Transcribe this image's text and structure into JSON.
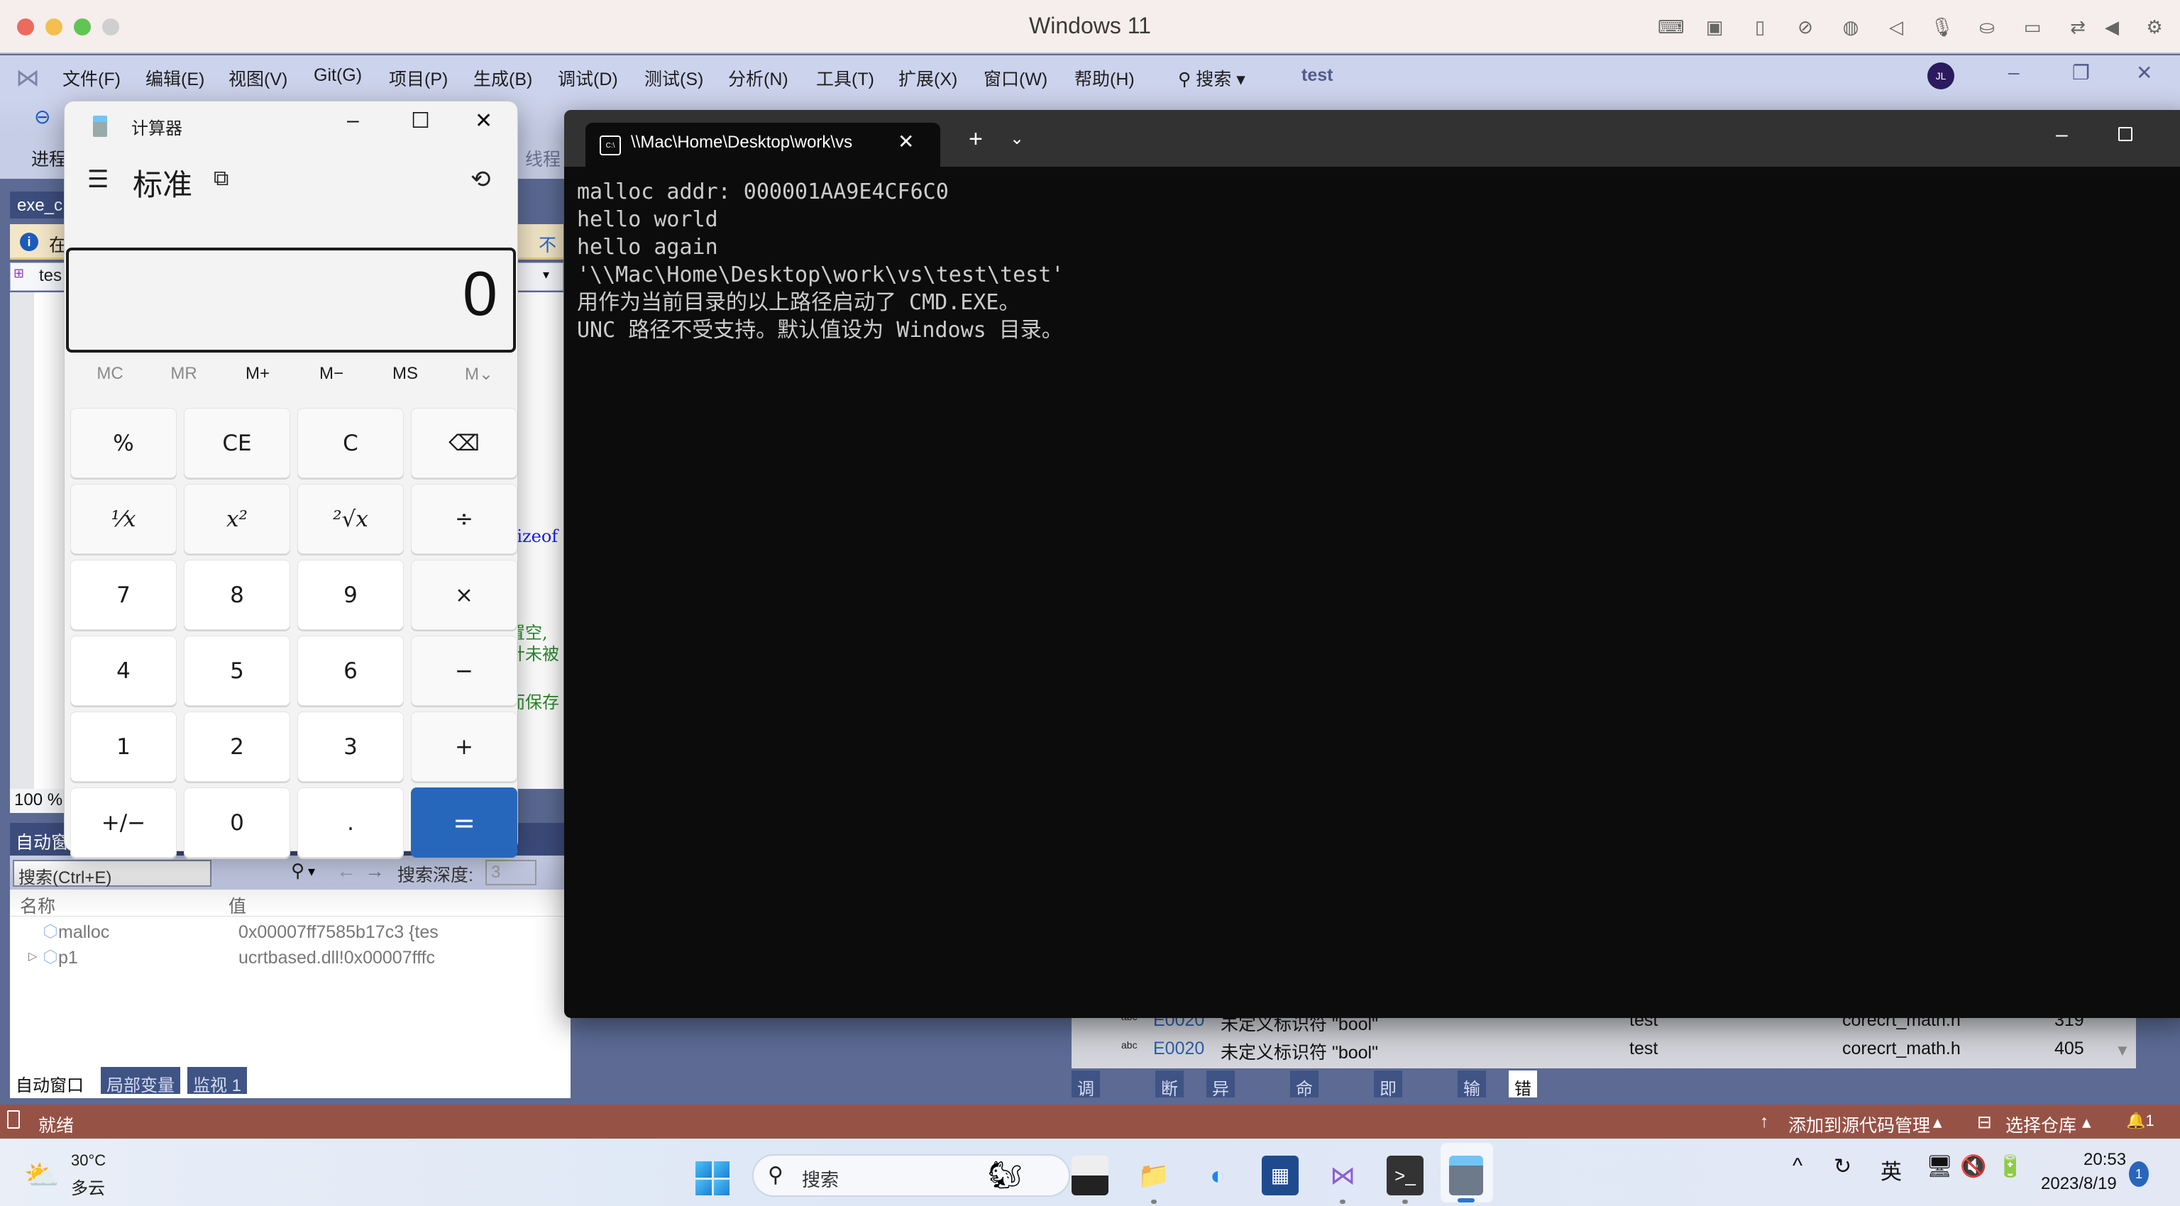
{
  "mac": {
    "title": "Windows 11",
    "traffic_lights": [
      "close",
      "minimize",
      "zoom",
      "fullscreen-disabled"
    ],
    "toolbar_icons": [
      "keyboard-icon",
      "cpu-icon",
      "usb-icon",
      "network-off-icon",
      "globe-icon",
      "speaker-icon",
      "microphone-icon",
      "disk-icon",
      "camera-icon",
      "share-icon",
      "arrow-left-icon",
      "gear-icon"
    ]
  },
  "vs": {
    "menu": [
      "文件(F)",
      "编辑(E)",
      "视图(V)",
      "Git(G)",
      "项目(P)",
      "生成(B)",
      "调试(D)",
      "测试(S)",
      "分析(N)",
      "工具(T)",
      "扩展(X)",
      "窗口(W)",
      "帮助(H)"
    ],
    "search_label": "搜索",
    "solution_name": "test",
    "avatar": "JL",
    "toolbar_process_label": "进程",
    "toolbar_thread_label": "线程",
    "doc_tab": "exe_c",
    "infobar_text": "在",
    "infobar_link": "不再",
    "nav_text": "tes",
    "code_fragments": [
      "sizeof",
      "置空,",
      "针未被",
      "而保存"
    ],
    "zoom_level": "100 %",
    "status_text": "就绪",
    "status_add_source": "添加到源代码管理",
    "status_select_repo": "选择仓库",
    "notifications": "1"
  },
  "auto_window": {
    "title": "自动窗口",
    "search_placeholder": "搜索(Ctrl+E)",
    "depth_label": "搜索深度:",
    "depth_value": "3",
    "columns": [
      "名称",
      "值"
    ],
    "rows": [
      {
        "name": "malloc",
        "value": "0x00007ff7585b17c3 {tes"
      },
      {
        "name": "p1",
        "value": "ucrtbased.dll!0x00007fffc"
      }
    ],
    "tabs": [
      "自动窗口",
      "局部变量",
      "监视 1"
    ],
    "active_tab": 0
  },
  "error_list": {
    "rows": [
      {
        "code": "E0020",
        "desc": "未定义标识符 \"bool\"",
        "project": "test",
        "file": "corecrt_math.h",
        "line": "319"
      },
      {
        "code": "E0020",
        "desc": "未定义标识符 \"bool\"",
        "project": "test",
        "file": "corecrt_math.h",
        "line": "405"
      }
    ],
    "tabs": [
      "调用堆栈",
      "断点",
      "异常设置",
      "命令窗口",
      "即时窗口",
      "输出",
      "错误列表"
    ],
    "active_tab": 6
  },
  "calculator": {
    "title": "计算器",
    "mode": "标准",
    "display": "0",
    "memory": [
      {
        "label": "MC",
        "enabled": false
      },
      {
        "label": "MR",
        "enabled": false
      },
      {
        "label": "M+",
        "enabled": true
      },
      {
        "label": "M−",
        "enabled": true
      },
      {
        "label": "MS",
        "enabled": true
      },
      {
        "label": "M⌄",
        "enabled": false
      }
    ],
    "keys": [
      [
        "%",
        "CE",
        "C",
        "⌫"
      ],
      [
        "¹⁄x",
        "x²",
        "²√x",
        "÷"
      ],
      [
        "7",
        "8",
        "9",
        "×"
      ],
      [
        "4",
        "5",
        "6",
        "−"
      ],
      [
        "1",
        "2",
        "3",
        "+"
      ],
      [
        "+/−",
        "0",
        ".",
        "="
      ]
    ]
  },
  "terminal": {
    "tab_title": "\\\\Mac\\Home\\Desktop\\work\\vs",
    "output": [
      "malloc addr: 000001AA9E4CF6C0",
      "hello world",
      "hello again",
      "'\\\\Mac\\Home\\Desktop\\work\\vs\\test\\test'",
      "用作为当前目录的以上路径启动了 CMD.EXE。",
      "UNC 路径不受支持。默认值设为 Windows 目录。"
    ]
  },
  "taskbar": {
    "weather_temp": "30°C",
    "weather_desc": "多云",
    "search_placeholder": "搜索",
    "apps": [
      "file-explorer-app",
      "edge-app",
      "store-app",
      "visual-studio-app",
      "terminal-app",
      "calculator-app"
    ],
    "active_app": "calculator-app",
    "tray_input": "英",
    "time": "20:53",
    "date": "2023/8/19",
    "notification_count": "1"
  }
}
